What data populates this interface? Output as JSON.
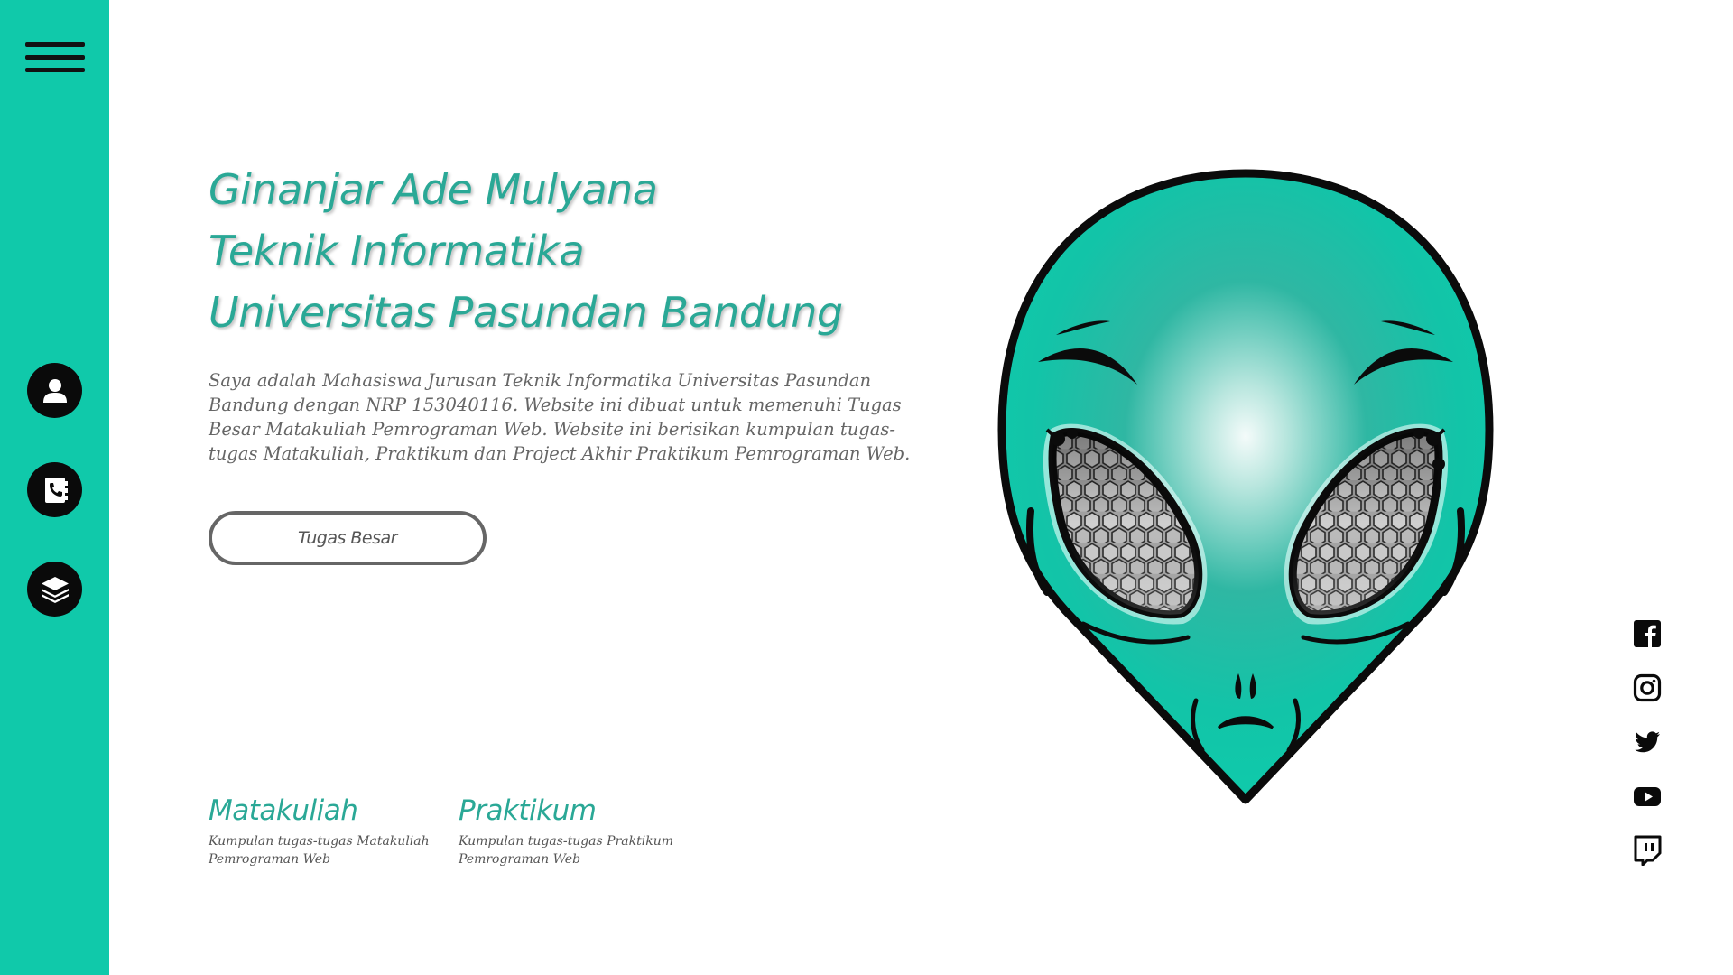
{
  "sidebar": {
    "menu_icon": "hamburger-menu-icon",
    "items": [
      {
        "icon": "user-icon"
      },
      {
        "icon": "contact-book-phone-icon"
      },
      {
        "icon": "layers-icon"
      }
    ]
  },
  "hero": {
    "title_lines": [
      "Ginanjar Ade Mulyana",
      "Teknik Informatika",
      "Universitas Pasundan Bandung"
    ],
    "intro": "Saya adalah Mahasiswa Jurusan Teknik Informatika Universitas Pasundan Bandung dengan NRP 153040116. Website ini dibuat untuk memenuhi Tugas Besar Matakuliah Pemrograman Web. Website ini berisikan kumpulan tugas-tugas Matakuliah, Praktikum dan Project Akhir Praktikum Pemrograman Web.",
    "button_label": "Tugas Besar"
  },
  "sections": [
    {
      "title": "Matakuliah",
      "desc_lines": [
        "Kumpulan tugas-tugas Matakuliah",
        "Pemrograman Web"
      ]
    },
    {
      "title": "Praktikum",
      "desc_lines": [
        "Kumpulan tugas-tugas Praktikum",
        "Pemrograman Web"
      ]
    }
  ],
  "social": [
    "facebook-icon",
    "instagram-icon",
    "twitter-icon",
    "youtube-icon",
    "twitch-icon"
  ],
  "colors": {
    "accent": "#10c9aa",
    "title": "#2aa896",
    "text": "#666666",
    "icon": "#0a0a0a"
  }
}
